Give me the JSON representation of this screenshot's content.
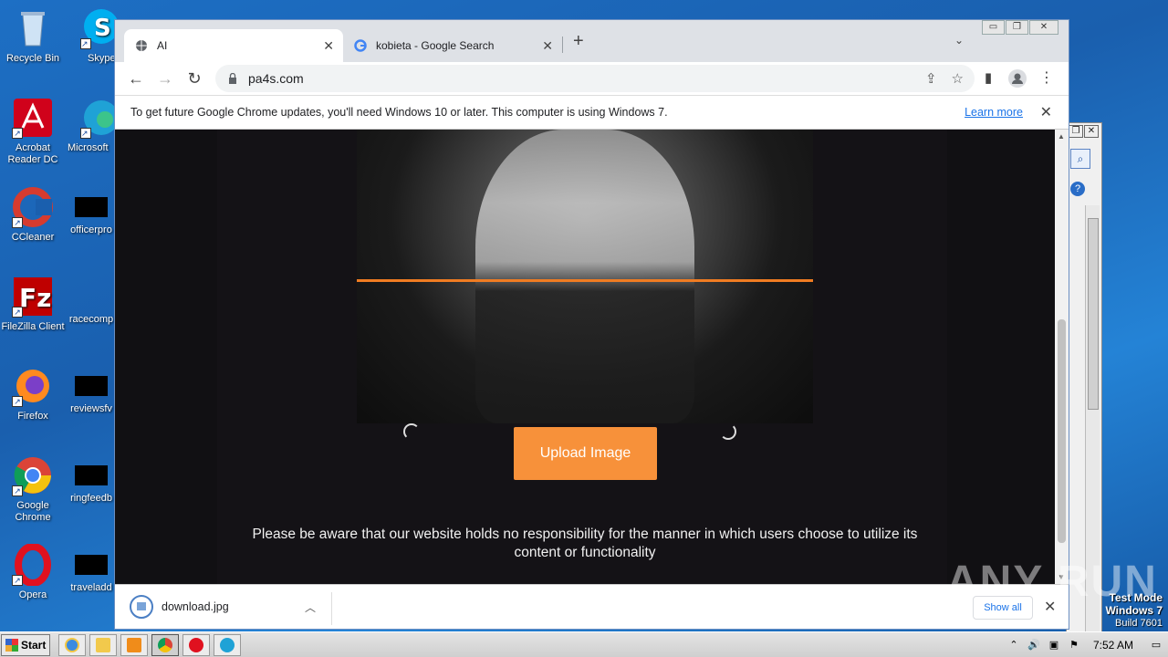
{
  "desktop": {
    "icons": [
      {
        "label": "Recycle Bin",
        "icon": "recycle-bin-icon"
      },
      {
        "label": "Skype",
        "icon": "skype-icon"
      },
      {
        "label": "Acrobat Reader DC",
        "icon": "acrobat-icon"
      },
      {
        "label": "Microsoft",
        "icon": "edge-icon"
      },
      {
        "label": "CCleaner",
        "icon": "ccleaner-icon"
      },
      {
        "label": "officerpro",
        "icon": "redacted-file-icon"
      },
      {
        "label": "FileZilla Client",
        "icon": "filezilla-icon"
      },
      {
        "label": "racecomp",
        "icon": "redacted-file-icon"
      },
      {
        "label": "Firefox",
        "icon": "firefox-icon"
      },
      {
        "label": "reviewsfv",
        "icon": "redacted-file-icon"
      },
      {
        "label": "Google Chrome",
        "icon": "chrome-icon"
      },
      {
        "label": "ringfeedb",
        "icon": "redacted-file-icon"
      },
      {
        "label": "Opera",
        "icon": "opera-icon"
      },
      {
        "label": "traveladd",
        "icon": "redacted-file-icon"
      }
    ],
    "test_mode": {
      "line1": "Test Mode",
      "line2": "Windows 7",
      "line3": "Build 7601"
    },
    "watermark": "ANY RUN"
  },
  "browser": {
    "tabs": [
      {
        "title": "AI",
        "active": true,
        "icon": "globe-icon"
      },
      {
        "title": "kobieta - Google Search",
        "active": false,
        "icon": "google-icon"
      }
    ],
    "url": "pa4s.com",
    "infobar": {
      "message": "To get future Google Chrome updates, you'll need Windows 10 or later. This computer is using Windows 7.",
      "link": "Learn more"
    },
    "page": {
      "upload_button": "Upload Image",
      "disclaimer": "Please be aware that our website holds no responsibility for the manner in which users choose to utilize its content or functionality"
    },
    "downloads": {
      "file": "download.jpg",
      "show_all": "Show all"
    }
  },
  "taskbar": {
    "start": "Start",
    "apps": [
      "ie-icon",
      "explorer-icon",
      "media-player-icon",
      "chrome-icon",
      "opera-icon",
      "edge-icon"
    ],
    "clock": "7:52 AM"
  },
  "colors": {
    "accent_orange": "#f7913a",
    "scanline": "#f07c22",
    "page_bg": "#111013"
  }
}
